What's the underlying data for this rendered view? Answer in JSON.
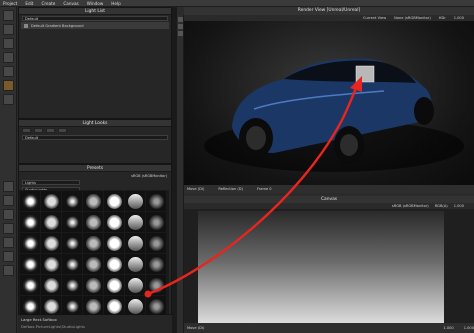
{
  "menu": [
    "Project",
    "Edit",
    "Create",
    "Canvas",
    "Window",
    "Help"
  ],
  "light_list": {
    "title": "Light List",
    "preset_field": "Default",
    "item": "Default Gradient Background"
  },
  "light_looks": {
    "title": "Light Looks",
    "field": "Default"
  },
  "presets": {
    "title": "Presets",
    "colorspace": "sRGB (sRGBMonitor)",
    "filter": "Lights",
    "category": "StudioLights",
    "footer_title": "Large Rect.Softbox",
    "footer_path": "Defbox.PictureLights\\StudioLights"
  },
  "render_view": {
    "title": "Render View [Unreal/Unreal]",
    "current_view": "Current View",
    "tonemap": "None (sRGBMonitor)",
    "hdr": "HDr",
    "zoom": "1.000",
    "move": "Move (Di)",
    "reflection": "Reflection (D)",
    "frame": "Frame 0"
  },
  "canvas": {
    "title": "Canvas",
    "colorspace": "sRGB (sRGBMonitor)",
    "mode": "RGB(A)",
    "zoom": "1.000",
    "move": "Move (Di)",
    "x_val": "1.000",
    "y_val": "1.000"
  },
  "accent": "#e8251f"
}
